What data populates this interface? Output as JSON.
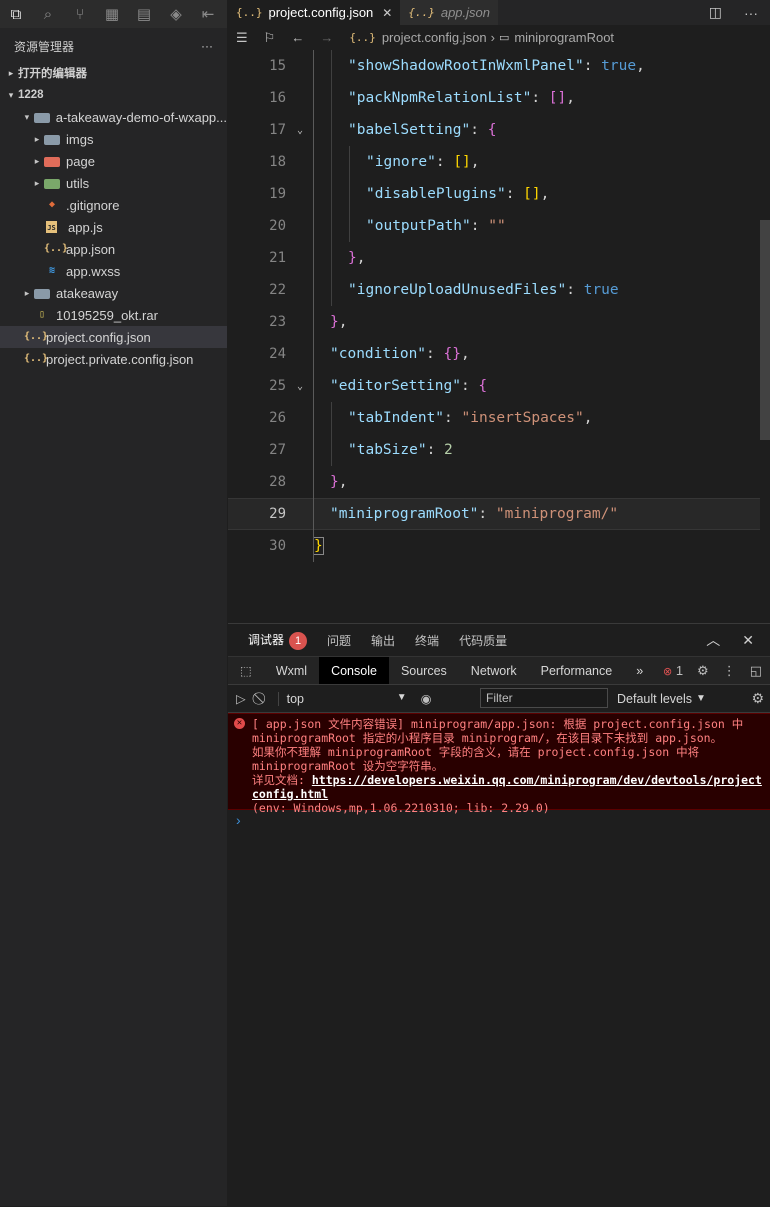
{
  "sidebar": {
    "title": "资源管理器",
    "more": "···",
    "sections": {
      "open_editors": "打开的编辑器",
      "workspace": "1228"
    },
    "tree": [
      {
        "label": "a-takeaway-demo-of-wxapp...",
        "indent": 1,
        "twisty": "▾",
        "icon": "folder-dark",
        "selected": false
      },
      {
        "label": "imgs",
        "indent": 2,
        "twisty": "▸",
        "icon": "folder",
        "selected": false
      },
      {
        "label": "page",
        "indent": 2,
        "twisty": "▸",
        "icon": "folder-red",
        "selected": false
      },
      {
        "label": "utils",
        "indent": 2,
        "twisty": "▸",
        "icon": "folder-green",
        "selected": false
      },
      {
        "label": ".gitignore",
        "indent": 2,
        "twisty": "",
        "icon": "git",
        "selected": false
      },
      {
        "label": "app.js",
        "indent": 2,
        "twisty": "",
        "icon": "js",
        "selected": false
      },
      {
        "label": "app.json",
        "indent": 2,
        "twisty": "",
        "icon": "json",
        "selected": false
      },
      {
        "label": "app.wxss",
        "indent": 2,
        "twisty": "",
        "icon": "css",
        "selected": false
      },
      {
        "label": "atakeaway",
        "indent": 1,
        "twisty": "▸",
        "icon": "folder",
        "selected": false
      },
      {
        "label": "10195259_okt.rar",
        "indent": 1,
        "twisty": "",
        "icon": "archive",
        "selected": false
      },
      {
        "label": "project.config.json",
        "indent": 0,
        "twisty": "",
        "icon": "json",
        "selected": true
      },
      {
        "label": "project.private.config.json",
        "indent": 0,
        "twisty": "",
        "icon": "json",
        "selected": false
      }
    ]
  },
  "editor": {
    "tabs": [
      {
        "label": "project.config.json",
        "active": true
      },
      {
        "label": "app.json",
        "active": false
      }
    ],
    "breadcrumb": {
      "file": "project.config.json",
      "separator": "›",
      "symbol": "miniprogramRoot"
    },
    "lines": [
      {
        "n": "15",
        "fold": ""
      },
      {
        "n": "16",
        "fold": ""
      },
      {
        "n": "17",
        "fold": "v"
      },
      {
        "n": "18",
        "fold": ""
      },
      {
        "n": "19",
        "fold": ""
      },
      {
        "n": "20",
        "fold": ""
      },
      {
        "n": "21",
        "fold": ""
      },
      {
        "n": "22",
        "fold": ""
      },
      {
        "n": "23",
        "fold": ""
      },
      {
        "n": "24",
        "fold": ""
      },
      {
        "n": "25",
        "fold": "v"
      },
      {
        "n": "26",
        "fold": ""
      },
      {
        "n": "27",
        "fold": ""
      },
      {
        "n": "28",
        "fold": ""
      },
      {
        "n": "29",
        "fold": ""
      },
      {
        "n": "30",
        "fold": ""
      }
    ],
    "code": {
      "l15_key": "\"showShadowRootInWxmlPanel\"",
      "l15_val": "true",
      "l16_key": "\"packNpmRelationList\"",
      "l16_val": "[]",
      "l17_key": "\"babelSetting\"",
      "l17_open": "{",
      "l18_key": "\"ignore\"",
      "l18_val": "[]",
      "l19_key": "\"disablePlugins\"",
      "l19_val": "[]",
      "l20_key": "\"outputPath\"",
      "l20_val": "\"\"",
      "l21_close": "}",
      "l22_key": "\"ignoreUploadUnusedFiles\"",
      "l22_val": "true",
      "l23_close": "}",
      "l24_key": "\"condition\"",
      "l24_val": "{}",
      "l25_key": "\"editorSetting\"",
      "l25_open": "{",
      "l26_key": "\"tabIndent\"",
      "l26_val": "\"insertSpaces\"",
      "l27_key": "\"tabSize\"",
      "l27_val": "2",
      "l28_close": "}",
      "l29_key": "\"miniprogramRoot\"",
      "l29_val": "\"miniprogram/\"",
      "l30_close": "}"
    }
  },
  "panel": {
    "tabs": [
      "调试器",
      "问题",
      "输出",
      "终端",
      "代码质量"
    ],
    "debugger_badge": "1",
    "devtools_tabs": [
      "Wxml",
      "Console",
      "Sources",
      "Network",
      "Performance"
    ],
    "more_tabs": "»",
    "error_count": "1",
    "console": {
      "context": "top",
      "filter_placeholder": "Filter",
      "levels": "Default levels",
      "error_lines": [
        "[ app.json 文件内容错误] miniprogram/app.json: 根据 project.config.json 中",
        "miniprogramRoot 指定的小程序目录 miniprogram/，在该目录下未找到 app.json。",
        "如果你不理解 miniprogramRoot 字段的含义，请在 project.config.json 中将",
        "miniprogramRoot 设为空字符串。",
        "详见文档: "
      ],
      "doc_link": "https://developers.weixin.qq.com/miniprogram/dev/devtools/projectconfig.html",
      "env_line": "(env: Windows,mp,1.06.2210310; lib: 2.29.0)",
      "prompt": "›"
    }
  },
  "colors": {
    "key": "#9cdcfe",
    "string": "#ce9178",
    "keyword": "#569cd6",
    "number": "#b5cea8",
    "error_bg": "#290000",
    "error_text": "#ff8080"
  }
}
